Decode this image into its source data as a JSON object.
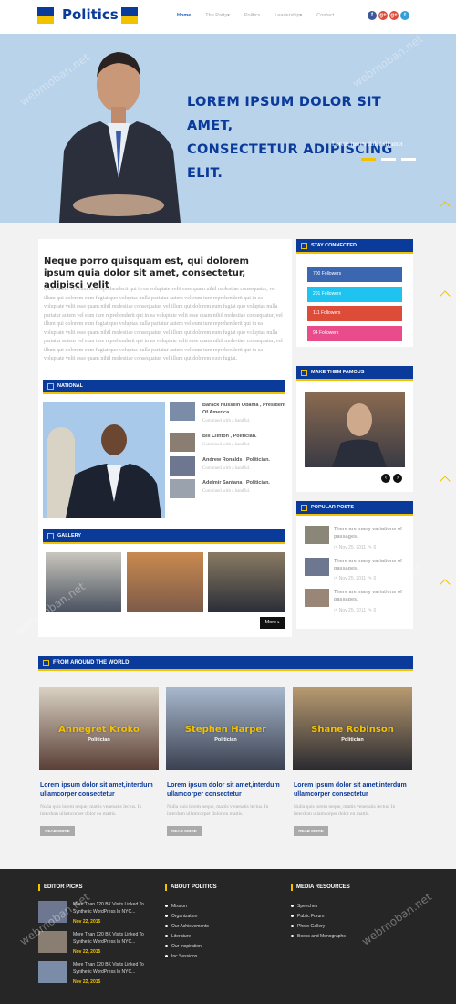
{
  "header": {
    "logo": "Politics",
    "nav": [
      "Home",
      "The Party",
      "Politics",
      "Leadership",
      "Contact"
    ],
    "social": [
      "f",
      "g+",
      "g+",
      "t"
    ]
  },
  "hero": {
    "title_line1": "LOREM IPSUM DOLOR SIT AMET,",
    "title_line2": "CONSECTETUR ADIPISCING ELIT.",
    "subtitle": "Lorem ipsum dolor sit amet"
  },
  "article": {
    "title": "Neque porro quisquam est, qui dolorem ipsum quia dolor sit amet, consectetur, adipisci velit",
    "body": "Quis autem vel eum iure reprehenderit qui in ea voluptate velit esse quam nihil molestiae consequatur, vel illum qui dolorem eum fugiat quo voluptas nulla pariatur autem vel eum iure reprehenderit qui in ea voluptate velit esse quam nihil molestiae consequatur, vel illum qui dolorem eum fugiat quo voluptas nulla pariatur autem vel eum iure reprehenderit qui in ea voluptate velit esse quam nihil molestiae consequatur, vel illum qui dolorem eum fugiat quo voluptas nulla pariatur autem vel eum iure reprehenderit qui in ea voluptate velit esse quam nihil molestiae consequatur, vel illum qui dolorem eum fugiat quo voluptas nulla pariatur autem vel eum iure reprehenderit qui in ea voluptate velit esse quam nihil molestiae consequatur, vel illum qui dolorem eum fugiat quo voluptas nulla pariatur autem vel eum iure reprehenderit qui in ea voluptate velit esse quam nihil molestiae consequatur, vel illum qui dolorem eum fugiat."
  },
  "national": {
    "heading": "NATIONAL",
    "items": [
      {
        "title": "Barack Hussein Obama , President Of America.",
        "sub": "Combined with a handful."
      },
      {
        "title": "Bill Clinton , Politician.",
        "sub": "Combined with a handful."
      },
      {
        "title": "Andrew Ronalds , Politician.",
        "sub": "Combined with a handful."
      },
      {
        "title": "Adelmir Santana , Politician.",
        "sub": "Combined with a handful."
      }
    ]
  },
  "gallery": {
    "heading": "GALLERY",
    "more": "More"
  },
  "sidebar": {
    "stay_connected": "STAY CONNECTED",
    "stats": [
      {
        "count": "700",
        "label": "Followers",
        "color": "#3b66b0"
      },
      {
        "count": "201",
        "label": "Followers",
        "color": "#1ec4ef"
      },
      {
        "count": "111",
        "label": "Followers",
        "color": "#dd4b39"
      },
      {
        "count": "94",
        "label": "Followers",
        "color": "#e84c8a"
      }
    ],
    "famous": "MAKE THEM FAMOUS",
    "popular": "POPULAR POSTS",
    "posts": [
      {
        "title": "There are many variations of passages.",
        "date": "Nov 25, 2011",
        "comments": "0"
      },
      {
        "title": "There are many variations of passages.",
        "date": "Nov 25, 2011",
        "comments": "0"
      },
      {
        "title": "There are many variations of passages.",
        "date": "Nov 25, 2011",
        "comments": "0"
      }
    ]
  },
  "world": {
    "heading": "FROM AROUND THE WORLD",
    "cards": [
      {
        "name": "Annegret Kroko",
        "role": "Politician",
        "title": "Lorem ipsum dolor sit amet,interdum ullamcorper consectetur",
        "desc": "Nulla quis lorem neque, mattis venenatis lectus. In interdum ullamcorper dolor eu mattis.",
        "btn": "READ MORE"
      },
      {
        "name": "Stephen Harper",
        "role": "Politician",
        "title": "Lorem ipsum dolor sit amet,interdum ullamcorper consectetur",
        "desc": "Nulla quis lorem neque, mattis venenatis lectus. In interdum ullamcorper dolor eu mattis.",
        "btn": "READ MORE"
      },
      {
        "name": "Shane Robinson",
        "role": "Politician",
        "title": "Lorem ipsum dolor sit amet,interdum ullamcorper consectetur",
        "desc": "Nulla quis lorem neque, mattis venenatis lectus. In interdum ullamcorper dolor eu mattis.",
        "btn": "READ MORE"
      }
    ]
  },
  "footer": {
    "editor": "EDITOR PICKS",
    "picks": [
      {
        "title": "More Than 120 BK Visits Linked To Synthetic WordPress In NYC...",
        "date": "Nov 22, 2015"
      },
      {
        "title": "More Than 120 BK Visits Linked To Synthetic WordPress In NYC...",
        "date": "Nov 22, 2015"
      },
      {
        "title": "More Than 120 BK Visits Linked To Synthetic WordPress In NYC...",
        "date": "Nov 22, 2015"
      }
    ],
    "about": "ABOUT POLITICS",
    "about_links": [
      "Mission",
      "Organization",
      "Our Achievements",
      "Literature",
      "Our Inspiration",
      "Inc Sessions"
    ],
    "media": "MEDIA RESOURCES",
    "media_links": [
      "Speeches",
      "Public Forum",
      "Photo Gallery",
      "Books and Monographs"
    ]
  },
  "watermark": "webmoban.net"
}
